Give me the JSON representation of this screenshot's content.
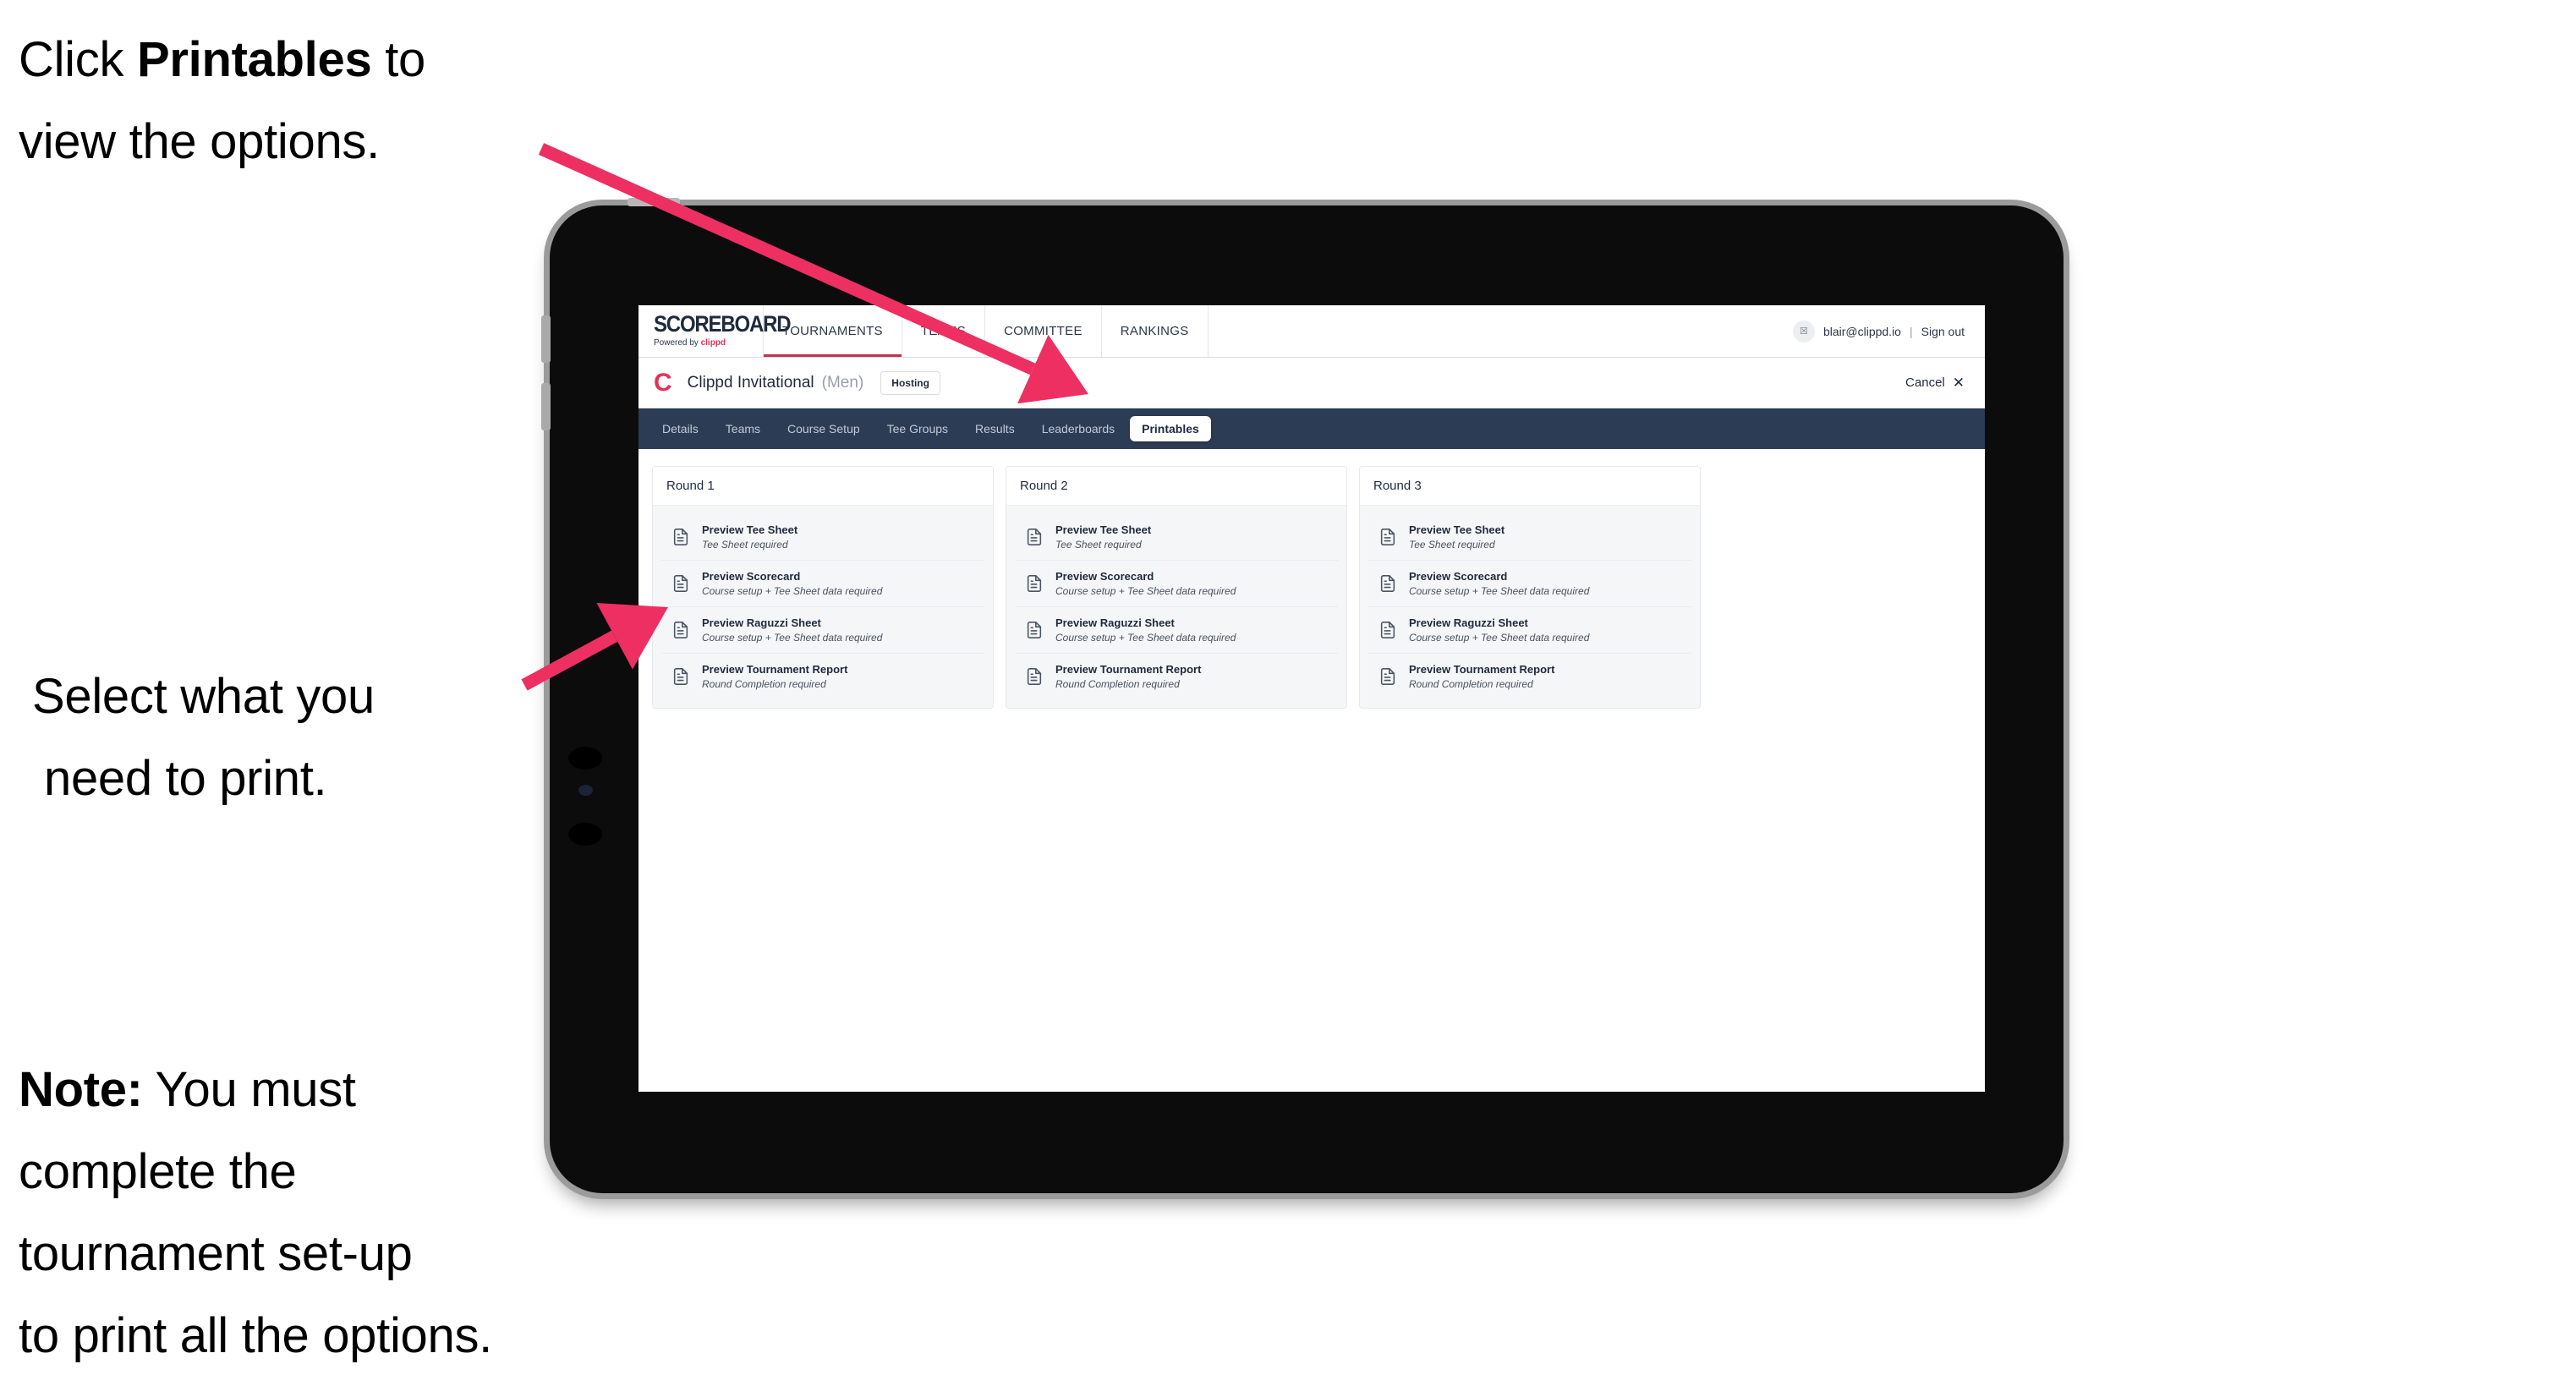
{
  "annotations": {
    "top": {
      "pre": "Click ",
      "bold": "Printables",
      "post": " to",
      "line2": "view the options."
    },
    "middle": {
      "line1": "Select what you",
      "line2": "need to print."
    },
    "note": {
      "bold": "Note:",
      "rest": " You must",
      "line2": "complete the",
      "line3": "tournament set-up",
      "line4": "to print all the options."
    }
  },
  "colors": {
    "arrow_pink": "#ED2F62",
    "tabbar_navy": "#2D3C55",
    "brand_pink": "#E0335B",
    "tablet_body": "#0C0C0C",
    "tablet_bezel": "#9B9B9B"
  },
  "app": {
    "topnav": {
      "brand_word": "SCOREBOARD",
      "brand_sub_prefix": "Powered by ",
      "brand_sub_name": "clippd",
      "items": [
        {
          "label": "TOURNAMENTS",
          "active": true
        },
        {
          "label": "TEAMS",
          "active": false
        },
        {
          "label": "COMMITTEE",
          "active": false
        },
        {
          "label": "RANKINGS",
          "active": false
        }
      ],
      "avatar_glyph": "☒",
      "user_email": "blair@clippd.io",
      "separator": "|",
      "signout_label": "Sign out"
    },
    "tournament_bar": {
      "logo_letter": "C",
      "name": "Clippd Invitational",
      "gender": "(Men)",
      "hosting_badge": "Hosting",
      "cancel_label": "Cancel",
      "cancel_x": "✕"
    },
    "tabs": [
      {
        "label": "Details",
        "active": false
      },
      {
        "label": "Teams",
        "active": false
      },
      {
        "label": "Course Setup",
        "active": false
      },
      {
        "label": "Tee Groups",
        "active": false
      },
      {
        "label": "Results",
        "active": false
      },
      {
        "label": "Leaderboards",
        "active": false
      },
      {
        "label": "Printables",
        "active": true
      }
    ],
    "rounds": [
      {
        "title": "Round 1",
        "documents": [
          {
            "title": "Preview Tee Sheet",
            "subtitle": "Tee Sheet required"
          },
          {
            "title": "Preview Scorecard",
            "subtitle": "Course setup + Tee Sheet data required"
          },
          {
            "title": "Preview Raguzzi Sheet",
            "subtitle": "Course setup + Tee Sheet data required"
          },
          {
            "title": "Preview Tournament Report",
            "subtitle": "Round Completion required"
          }
        ]
      },
      {
        "title": "Round 2",
        "documents": [
          {
            "title": "Preview Tee Sheet",
            "subtitle": "Tee Sheet required"
          },
          {
            "title": "Preview Scorecard",
            "subtitle": "Course setup + Tee Sheet data required"
          },
          {
            "title": "Preview Raguzzi Sheet",
            "subtitle": "Course setup + Tee Sheet data required"
          },
          {
            "title": "Preview Tournament Report",
            "subtitle": "Round Completion required"
          }
        ]
      },
      {
        "title": "Round 3",
        "documents": [
          {
            "title": "Preview Tee Sheet",
            "subtitle": "Tee Sheet required"
          },
          {
            "title": "Preview Scorecard",
            "subtitle": "Course setup + Tee Sheet data required"
          },
          {
            "title": "Preview Raguzzi Sheet",
            "subtitle": "Course setup + Tee Sheet data required"
          },
          {
            "title": "Preview Tournament Report",
            "subtitle": "Round Completion required"
          }
        ]
      }
    ]
  }
}
